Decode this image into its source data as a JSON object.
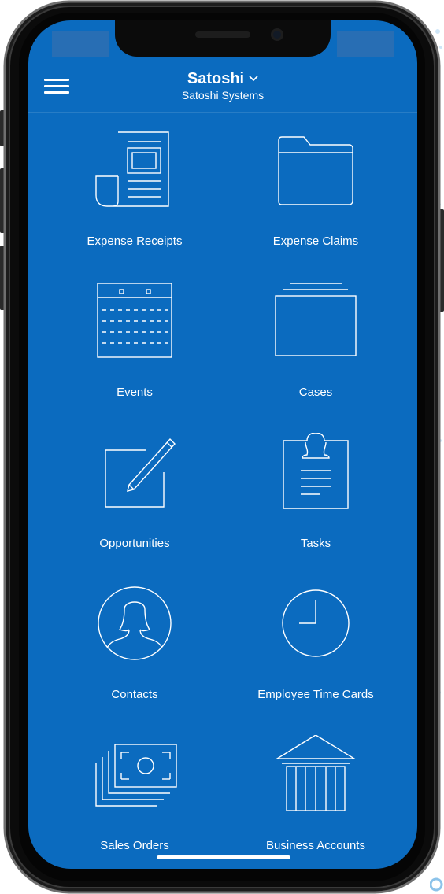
{
  "header": {
    "title": "Satoshi",
    "subtitle": "Satoshi Systems",
    "menu_icon": "hamburger-menu-icon",
    "dropdown_icon": "chevron-down-icon"
  },
  "tiles": [
    {
      "label": "Expense Receipts",
      "icon": "receipt-icon"
    },
    {
      "label": "Expense Claims",
      "icon": "folder-icon"
    },
    {
      "label": "Events",
      "icon": "calendar-icon"
    },
    {
      "label": "Cases",
      "icon": "case-stack-icon"
    },
    {
      "label": "Opportunities",
      "icon": "pencil-note-icon"
    },
    {
      "label": "Tasks",
      "icon": "clipboard-icon"
    },
    {
      "label": "Contacts",
      "icon": "person-icon"
    },
    {
      "label": "Employee Time Cards",
      "icon": "clock-icon"
    },
    {
      "label": "Sales Orders",
      "icon": "banknotes-icon"
    },
    {
      "label": "Business Accounts",
      "icon": "bank-building-icon"
    }
  ],
  "colors": {
    "screen_background": "#0b6bbf",
    "foreground": "#ffffff",
    "frame": "#0b0b0b"
  }
}
